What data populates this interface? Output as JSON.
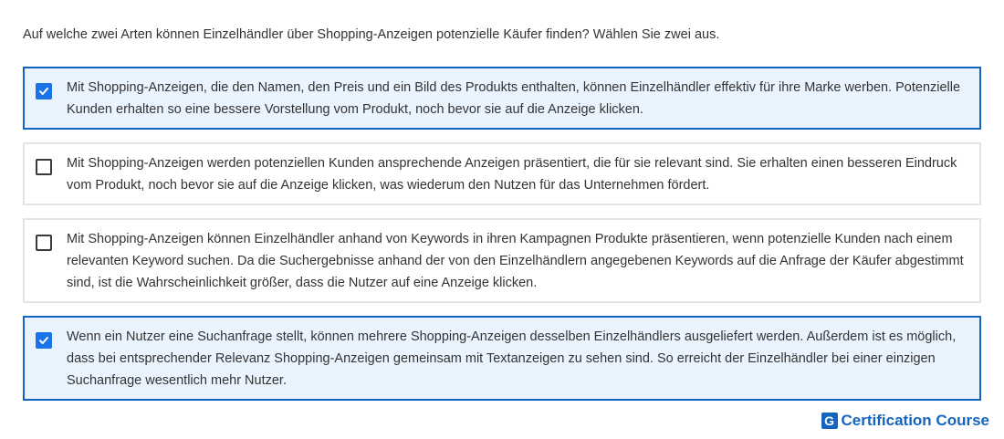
{
  "question": "Auf welche zwei Arten können Einzelhändler über Shopping-Anzeigen potenzielle Käufer finden? Wählen Sie zwei aus.",
  "options": [
    {
      "text": "Mit Shopping-Anzeigen, die den Namen, den Preis und ein Bild des Produkts enthalten, können Einzelhändler effektiv für ihre Marke werben. Potenzielle Kunden erhalten so eine bessere Vorstellung vom Produkt, noch bevor sie auf die Anzeige klicken.",
      "checked": true
    },
    {
      "text": "Mit Shopping-Anzeigen werden potenziellen Kunden ansprechende Anzeigen präsentiert, die für sie relevant sind. Sie erhalten einen besseren Eindruck vom Produkt, noch bevor sie auf die Anzeige klicken, was wiederum den Nutzen für das Unternehmen fördert.",
      "checked": false
    },
    {
      "text": "Mit Shopping-Anzeigen können Einzelhändler anhand von Keywords in ihren Kampagnen Produkte präsentieren, wenn potenzielle Kunden nach einem relevanten Keyword suchen. Da die Suchergebnisse anhand der von den Einzelhändlern angegebenen Keywords auf die Anfrage der Käufer abgestimmt sind, ist die Wahrscheinlichkeit größer, dass die Nutzer auf eine Anzeige klicken.",
      "checked": false
    },
    {
      "text": "Wenn ein Nutzer eine Suchanfrage stellt, können mehrere Shopping-Anzeigen desselben Einzelhändlers ausgeliefert werden. Außerdem ist es möglich, dass bei entsprechender Relevanz Shopping-Anzeigen gemeinsam mit Textanzeigen zu sehen sind. So erreicht der Einzelhändler bei einer einzigen Suchanfrage wesentlich mehr Nutzer.",
      "checked": true
    }
  ],
  "brand": {
    "logo_letter": "G",
    "name": "Certification Course"
  },
  "colors": {
    "accent": "#1565c0",
    "checkbox_fill": "#1a73e8",
    "selected_bg": "#eaf4ff",
    "border": "#e3e3e3"
  }
}
